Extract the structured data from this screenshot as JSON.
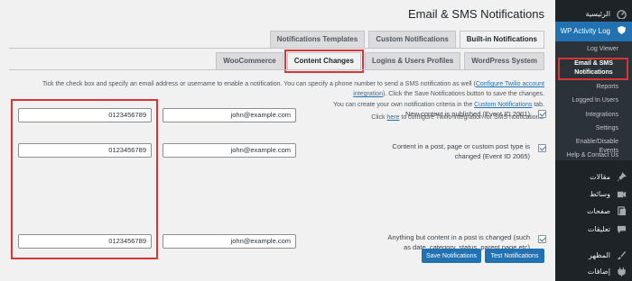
{
  "sidebar": {
    "items": [
      {
        "label": "الرئيسية",
        "icon": "dashboard-icon"
      },
      {
        "label": "WP Activity Log",
        "icon": "shield-icon"
      },
      {
        "label": "مقالات",
        "icon": "pin-icon"
      },
      {
        "label": "وسائط",
        "icon": "media-icon"
      },
      {
        "label": "صفحات",
        "icon": "page-icon"
      },
      {
        "label": "تعليقات",
        "icon": "comment-icon"
      },
      {
        "label": "المظهر",
        "icon": "brush-icon"
      },
      {
        "label": "إضافات",
        "icon": "plugin-icon"
      }
    ],
    "submenu": [
      "Log Viewer",
      "Email & SMS Notifications",
      "Reports",
      "Logged In Users",
      "Integrations",
      "Settings",
      "Enable/Disable Events",
      "Help & Contact Us"
    ],
    "current_line1": "Email & SMS",
    "current_line2": "Notifications"
  },
  "header": {
    "title": "Email & SMS Notifications"
  },
  "tabs_primary": [
    "Built-in Notifications",
    "Custom Notifications",
    "Notifications Templates"
  ],
  "tabs_secondary": [
    "WordPress System",
    "Logins & Users Profiles",
    "Content Changes",
    "WooCommerce"
  ],
  "description": {
    "line1_pre": "Tick the check box and specify an email address or username to enable a notification. You can specify a phone number to send a SMS notification as well (",
    "line1_link": "Configure Twilio account",
    "line2_link": "integration",
    "line2_post": "). Click the Save Notifications button to save the changes.",
    "line3_pre": "You can create your own notification criteria in the ",
    "line3_link": "Custom Notifications",
    "line3_post": " tab.",
    "line4_pre": "Click ",
    "line4_link": "here",
    "line4_post": " to configure Twilio integration for SMS notifications."
  },
  "notifications": [
    {
      "label": "New content is published (Event ID 2001)",
      "email": "john@example.com",
      "phone": "0123456789",
      "checked": true
    },
    {
      "label": "Content in a post, page or custom post type is changed (Event ID 2065)",
      "email": "john@example.com",
      "phone": "0123456789",
      "checked": true
    },
    {
      "label": "Anything but content in a post is changed (such as date, category, status, parent page etc)",
      "email": "john@example.com",
      "phone": "0123456789",
      "checked": true
    }
  ],
  "buttons": {
    "save": "Save Notifications",
    "test": "Test Notifications"
  },
  "colors": {
    "accent": "#2271b1",
    "highlight": "#d63638",
    "sidebar_bg": "#1d2327"
  }
}
